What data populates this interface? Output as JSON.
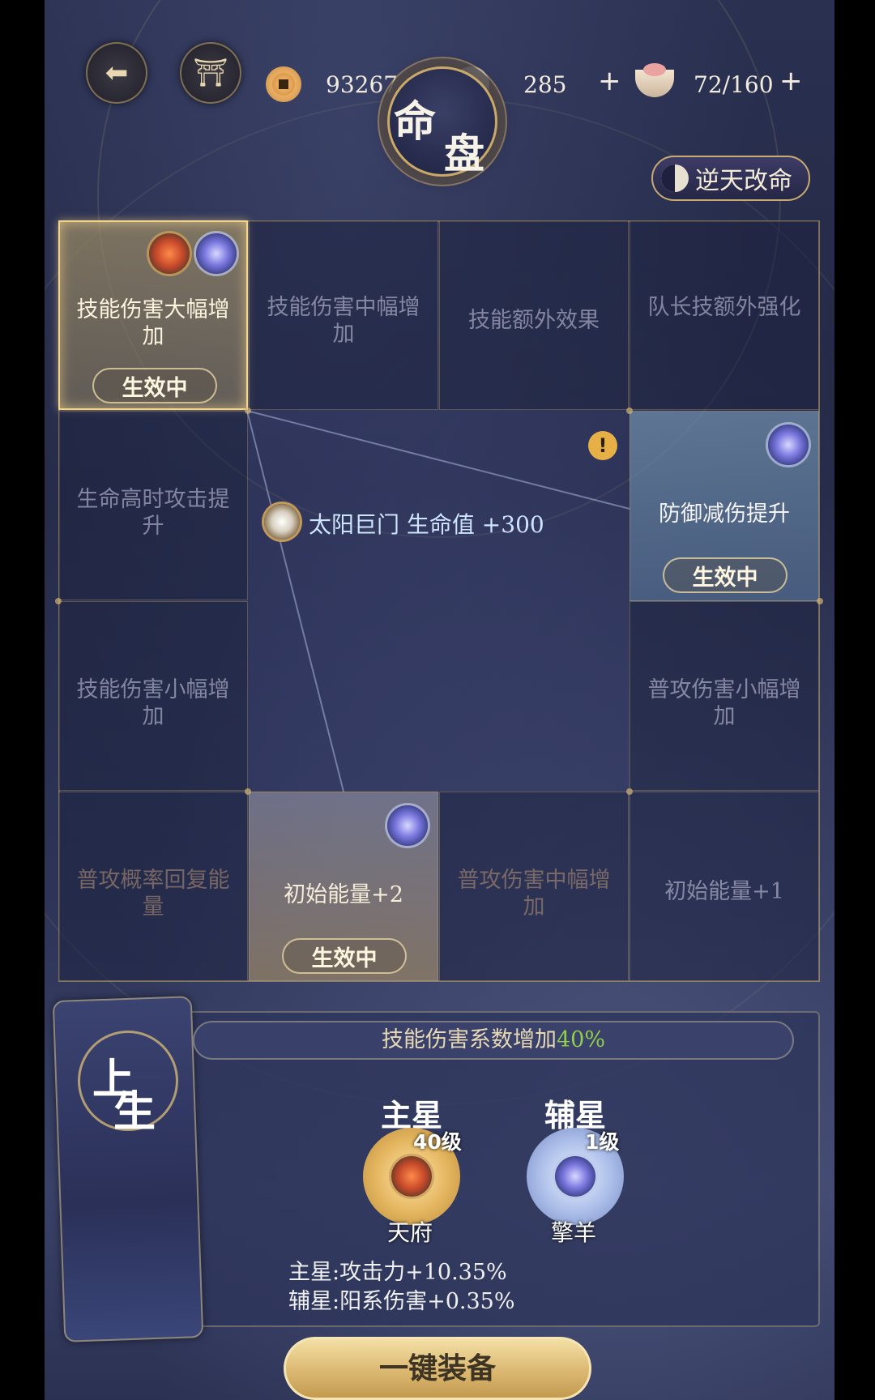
{
  "window": {
    "title_a": "命",
    "title_b": "盘"
  },
  "icons": {
    "back": "back-arrow-icon",
    "pavilion": "pavilion-icon",
    "coin": "copper-coin-icon",
    "jade": "silver-swirl-icon",
    "food": "rice-bowl-icon"
  },
  "currency": {
    "copper": {
      "value": "93267",
      "add": "+"
    },
    "silver": {
      "value": "285",
      "add": "+"
    },
    "stamina": {
      "value": "72/160",
      "add": "+"
    }
  },
  "header": {
    "fate_button": "逆天改命"
  },
  "grid": {
    "cells": [
      {
        "label": "技能伤害大幅增加",
        "status": "生效中"
      },
      {
        "label": "技能伤害中幅增加"
      },
      {
        "label": "技能额外效果"
      },
      {
        "label": "队长技额外强化"
      },
      {
        "label": "生命高时攻击提升"
      },
      {
        "label": "防御减伤提升",
        "status": "生效中"
      },
      {
        "label": "技能伤害小幅增加"
      },
      {
        "label": "普攻伤害小幅增加"
      },
      {
        "label": "普攻概率回复能量"
      },
      {
        "label": "初始能量+2",
        "status": "生效中"
      },
      {
        "label": "普攻伤害中幅增加"
      },
      {
        "label": "初始能量+1"
      }
    ],
    "center": {
      "text": "太阳巨门 生命值 +300",
      "alert": "!"
    }
  },
  "detail": {
    "palace_a": "上",
    "palace_b": "生",
    "effect_text": "技能伤害系数增加",
    "effect_value": "40%",
    "main_star": {
      "title": "主星",
      "level": "40级",
      "name": "天府"
    },
    "aux_star": {
      "title": "辅星",
      "level": "1级",
      "name": "擎羊"
    },
    "attr_main": "主星:攻击力+10.35%",
    "attr_aux": "辅星:阳系伤害+0.35%"
  },
  "footer": {
    "equip_button": "一键装备"
  },
  "colors": {
    "gold": "#caa867",
    "highlight_green": "#8fcf4a",
    "bg": "#232844"
  }
}
